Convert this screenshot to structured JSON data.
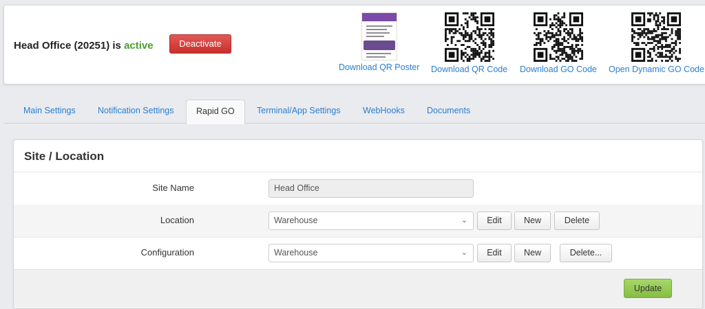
{
  "header": {
    "status_prefix": "Head Office (20251) is",
    "status_word": "active",
    "deactivate_label": "Deactivate",
    "downloads": [
      {
        "label": "Download QR Poster",
        "icon": "qr-poster-thumbnail-icon"
      },
      {
        "label": "Download QR Code",
        "icon": "qr-code-icon"
      },
      {
        "label": "Download GO Code",
        "icon": "qr-code-icon"
      },
      {
        "label": "Open Dynamic GO Code",
        "icon": "qr-code-icon"
      }
    ]
  },
  "tabs": [
    {
      "label": "Main Settings",
      "active": false
    },
    {
      "label": "Notification Settings",
      "active": false
    },
    {
      "label": "Rapid GO",
      "active": true
    },
    {
      "label": "Terminal/App Settings",
      "active": false
    },
    {
      "label": "WebHooks",
      "active": false
    },
    {
      "label": "Documents",
      "active": false
    }
  ],
  "panel": {
    "title": "Site / Location",
    "site_name": {
      "label": "Site Name",
      "value": "Head Office"
    },
    "location": {
      "label": "Location",
      "value": "Warehouse",
      "edit": "Edit",
      "new": "New",
      "delete": "Delete"
    },
    "configuration": {
      "label": "Configuration",
      "value": "Warehouse",
      "edit": "Edit",
      "new": "New",
      "delete": "Delete..."
    },
    "update_label": "Update"
  },
  "colors": {
    "link": "#2a7ed0",
    "active_status": "#4aa02c",
    "danger": "#c9302c",
    "success": "#86bd40"
  }
}
